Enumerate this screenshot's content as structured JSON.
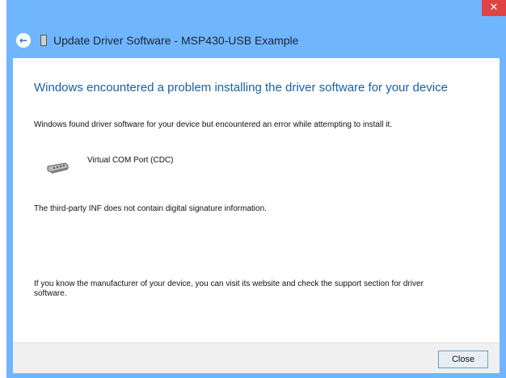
{
  "window": {
    "title": "Update Driver Software - MSP430-USB Example",
    "close_glyph": "✕",
    "back_glyph": "←",
    "accent": "#6fb6ff",
    "title_bar_close_color": "#e04343"
  },
  "content": {
    "heading": "Windows encountered a problem installing the driver software for your device",
    "paragraph1": "Windows found driver software for your device but encountered an error while attempting to install it.",
    "device_label": "Virtual COM Port (CDC)",
    "paragraph2": "The third-party INF does not contain digital signature information.",
    "paragraph3": "If you know the manufacturer of your device, you can visit its website and check the support section for driver software."
  },
  "footer": {
    "close_label": "Close"
  },
  "icons": {
    "back": "back-arrow-icon",
    "device": "device-icon",
    "port": "serial-port-icon",
    "window_close": "close-icon"
  }
}
